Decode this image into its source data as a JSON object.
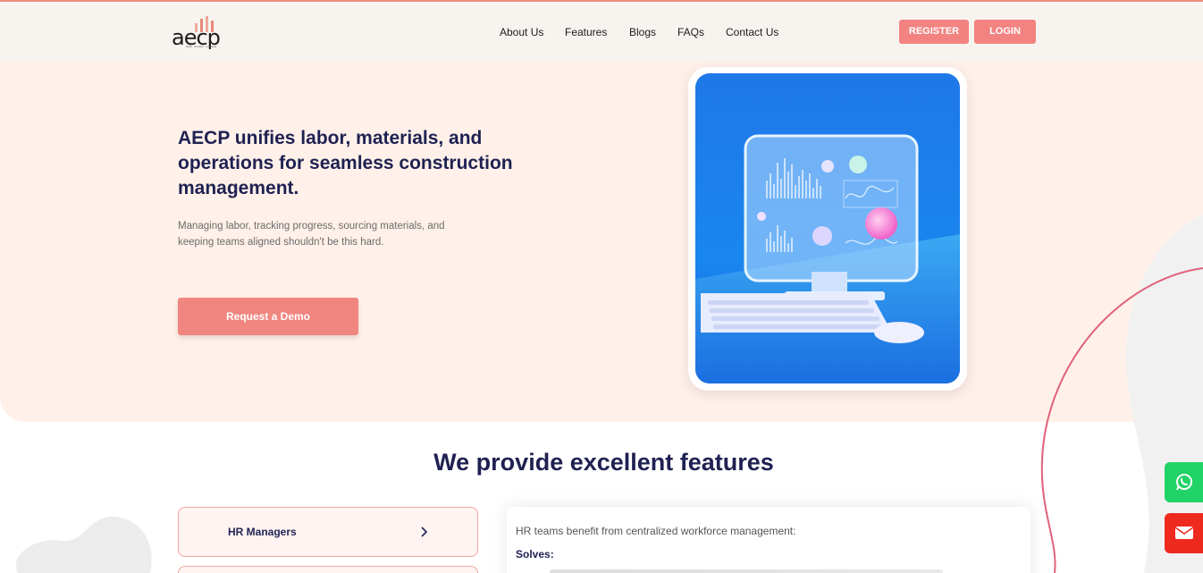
{
  "brand": {
    "logo_text": "aecp",
    "tagline": "build · connect · empower"
  },
  "nav": {
    "items": [
      {
        "label": "About Us"
      },
      {
        "label": "Features"
      },
      {
        "label": "Blogs"
      },
      {
        "label": "FAQs"
      },
      {
        "label": "Contact Us"
      }
    ],
    "register_label": "REGISTER",
    "login_label": "LOGIN"
  },
  "hero": {
    "title": "AECP unifies labor, materials, and operations for seamless construction management.",
    "subtitle": "Managing labor, tracking progress, sourcing materials, and keeping teams aligned shouldn't be this hard.",
    "cta_label": "Request a Demo"
  },
  "features": {
    "title": "We provide excellent features",
    "tabs": [
      {
        "label": "HR Managers"
      }
    ],
    "panel": {
      "intro": "HR teams benefit from centralized workforce management:",
      "solves_label": "Solves:"
    }
  },
  "colors": {
    "accent": "#f28380",
    "heading": "#1f2152",
    "hero_bg": "#fff1e9",
    "header_bg": "#f7f4f0",
    "whatsapp": "#21d366",
    "mail": "#ee2a1f"
  },
  "icons": {
    "whatsapp": "whatsapp-icon",
    "mail": "mail-icon",
    "chevron": "chevron-right-icon"
  }
}
